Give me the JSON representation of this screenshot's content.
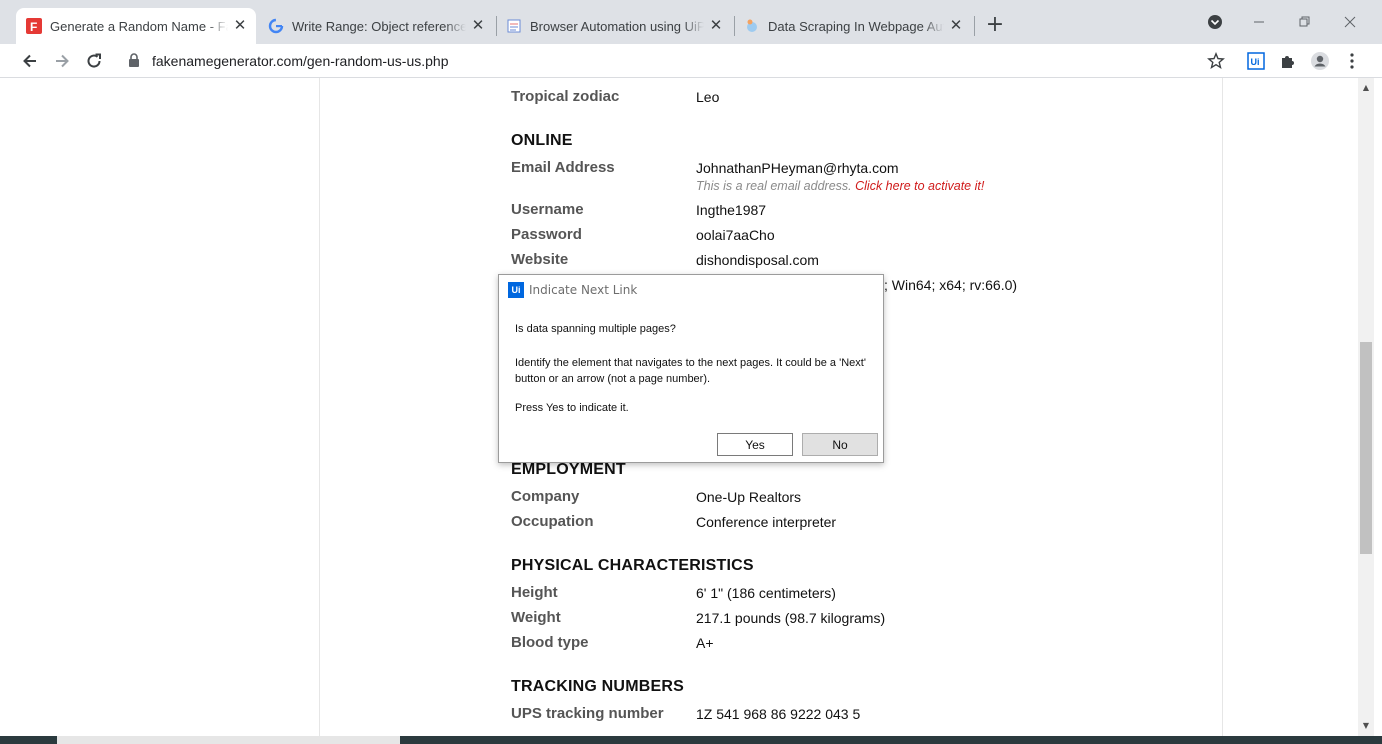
{
  "tabs": [
    {
      "title": "Generate a Random Name - Fake Name Generator",
      "favicon": "fakename-f-icon",
      "active": true
    },
    {
      "title": "Write Range: Object reference not set to an instance",
      "favicon": "google-g-icon",
      "active": false
    },
    {
      "title": "Browser Automation using UiPath",
      "favicon": "page-icon",
      "active": false
    },
    {
      "title": "Data Scraping In Webpage Automation",
      "favicon": "bot-icon",
      "active": false
    }
  ],
  "address_bar": {
    "url": "fakenamegenerator.com/gen-random-us-us.php"
  },
  "page": {
    "zodiac": {
      "label": "Tropical zodiac",
      "value": "Leo"
    },
    "online": {
      "heading": "ONLINE",
      "email": {
        "label": "Email Address",
        "value": "JohnathanPHeyman@rhyta.com",
        "note": "This is a real email address.",
        "activate": "Click here to activate it!"
      },
      "username": {
        "label": "Username",
        "value": "Ingthe1987"
      },
      "password": {
        "label": "Password",
        "value": "oolai7aaCho"
      },
      "website": {
        "label": "Website",
        "value": "dishondisposal.com"
      },
      "useragent_fragment": "; Win64; x64; rv:66.0)"
    },
    "employment": {
      "heading": "EMPLOYMENT",
      "company": {
        "label": "Company",
        "value": "One-Up Realtors"
      },
      "occupation": {
        "label": "Occupation",
        "value": "Conference interpreter"
      }
    },
    "physical": {
      "heading": "PHYSICAL CHARACTERISTICS",
      "height": {
        "label": "Height",
        "value": "6' 1\" (186 centimeters)"
      },
      "weight": {
        "label": "Weight",
        "value": "217.1 pounds (98.7 kilograms)"
      },
      "blood": {
        "label": "Blood type",
        "value": "A+"
      }
    },
    "tracking": {
      "heading": "TRACKING NUMBERS",
      "ups": {
        "label": "UPS tracking number",
        "value": "1Z 541 968 86 9222 043 5"
      }
    }
  },
  "dialog": {
    "title": "Indicate Next Link",
    "logo": "Ui",
    "question": "Is data spanning multiple pages?",
    "description": "Identify the element that navigates to the next pages. It could be a 'Next' button or an arrow (not a page number).",
    "instruction": "Press Yes to indicate it.",
    "yes_label": "Yes",
    "no_label": "No"
  },
  "extension": {
    "uipath_label": "Ui"
  },
  "colors": {
    "accent": "#0067df",
    "activate_link": "#d01c1c"
  }
}
